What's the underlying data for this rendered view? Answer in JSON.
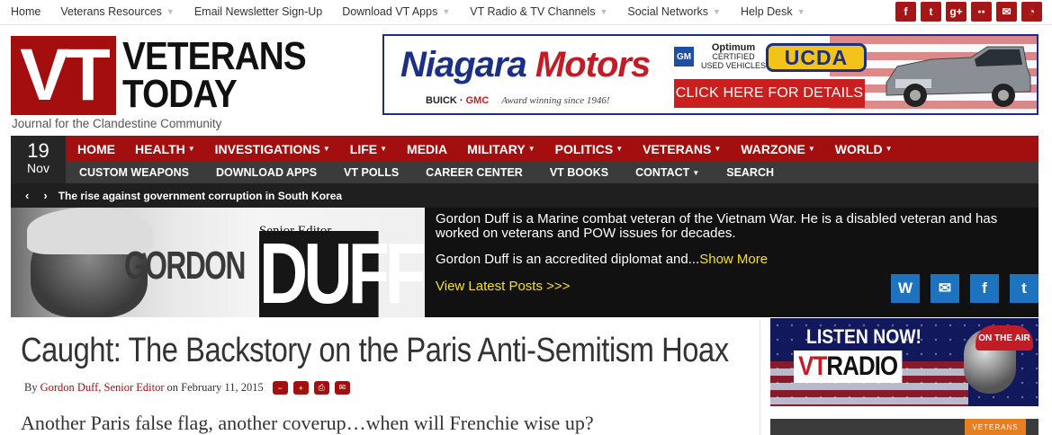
{
  "topnav": {
    "items": [
      {
        "label": "Home",
        "dropdown": false
      },
      {
        "label": "Veterans Resources",
        "dropdown": true
      },
      {
        "label": "Email Newsletter Sign-Up",
        "dropdown": false
      },
      {
        "label": "Download VT Apps",
        "dropdown": true
      },
      {
        "label": "VT Radio & TV Channels",
        "dropdown": true
      },
      {
        "label": "Social Networks",
        "dropdown": true
      },
      {
        "label": "Help Desk",
        "dropdown": true
      }
    ],
    "social": [
      {
        "icon": "facebook-icon",
        "glyph": "f"
      },
      {
        "icon": "twitter-icon",
        "glyph": "t"
      },
      {
        "icon": "google-plus-icon",
        "glyph": "g+"
      },
      {
        "icon": "flickr-icon",
        "glyph": "●●"
      },
      {
        "icon": "email-icon",
        "glyph": "✉"
      },
      {
        "icon": "rss-icon",
        "glyph": "◔"
      }
    ]
  },
  "logo": {
    "mark": "VT",
    "line1": "VETERANS",
    "line2": "TODAY",
    "tagline": "Journal for the Clandestine Community"
  },
  "ad": {
    "brand1": "Niagara",
    "brand2": "Motors",
    "makes1": "BUICK",
    "makes2": "GMC",
    "award": "Award winning since 1946!",
    "gm": "GM",
    "optimum1": "Optimum",
    "optimum2": "CERTIFIED",
    "optimum3": "USED VEHICLES",
    "ucda": "UCDA",
    "cta": "CLICK HERE FOR DETAILS"
  },
  "date": {
    "day": "19",
    "month": "Nov"
  },
  "mainnav": {
    "primary": [
      {
        "label": "HOME",
        "dropdown": false
      },
      {
        "label": "HEALTH",
        "dropdown": true
      },
      {
        "label": "INVESTIGATIONS",
        "dropdown": true
      },
      {
        "label": "LIFE",
        "dropdown": true
      },
      {
        "label": "MEDIA",
        "dropdown": false
      },
      {
        "label": "MILITARY",
        "dropdown": true
      },
      {
        "label": "POLITICS",
        "dropdown": true
      },
      {
        "label": "VETERANS",
        "dropdown": true
      },
      {
        "label": "WARZONE",
        "dropdown": true
      },
      {
        "label": "WORLD",
        "dropdown": true
      }
    ],
    "secondary": [
      {
        "label": "CUSTOM WEAPONS",
        "dropdown": false
      },
      {
        "label": "DOWNLOAD APPS",
        "dropdown": false
      },
      {
        "label": "VT POLLS",
        "dropdown": false
      },
      {
        "label": "CAREER CENTER",
        "dropdown": false
      },
      {
        "label": "VT BOOKS",
        "dropdown": false
      },
      {
        "label": "CONTACT",
        "dropdown": true
      },
      {
        "label": "SEARCH",
        "dropdown": false
      }
    ]
  },
  "ticker": {
    "prev": "‹",
    "next": "›",
    "headline": "The rise against government corruption in South Korea"
  },
  "author": {
    "role": "Senior Editor",
    "first": "GORDON",
    "last": "DUFF",
    "bio": "Gordon Duff is a Marine combat veteran of the Vietnam War. He is a disabled veteran and has worked on veterans and POW issues for decades.",
    "bio2": "Gordon Duff is an accredited diplomat and...",
    "show_more": "Show More",
    "latest": "View Latest Posts >>>",
    "icons": [
      {
        "icon": "wordpress-icon",
        "glyph": "W"
      },
      {
        "icon": "email-icon",
        "glyph": "✉"
      },
      {
        "icon": "facebook-icon",
        "glyph": "f"
      },
      {
        "icon": "twitter-icon",
        "glyph": "t"
      }
    ]
  },
  "article": {
    "title": "Caught: The Backstory on the Paris Anti-Semitism Hoax",
    "by": "By",
    "author": "Gordon Duff, Senior Editor",
    "on": "on February 11, 2015",
    "subtitle": "Another Paris false flag, another coverup…when will Frenchie wise up?"
  },
  "sidebar": {
    "radio_listen": "LISTEN NOW!",
    "radio_vt": "VT",
    "radio_name": "RADIO",
    "radio_onair": "ON THE AIR",
    "widget_tab": "VETERANS"
  }
}
